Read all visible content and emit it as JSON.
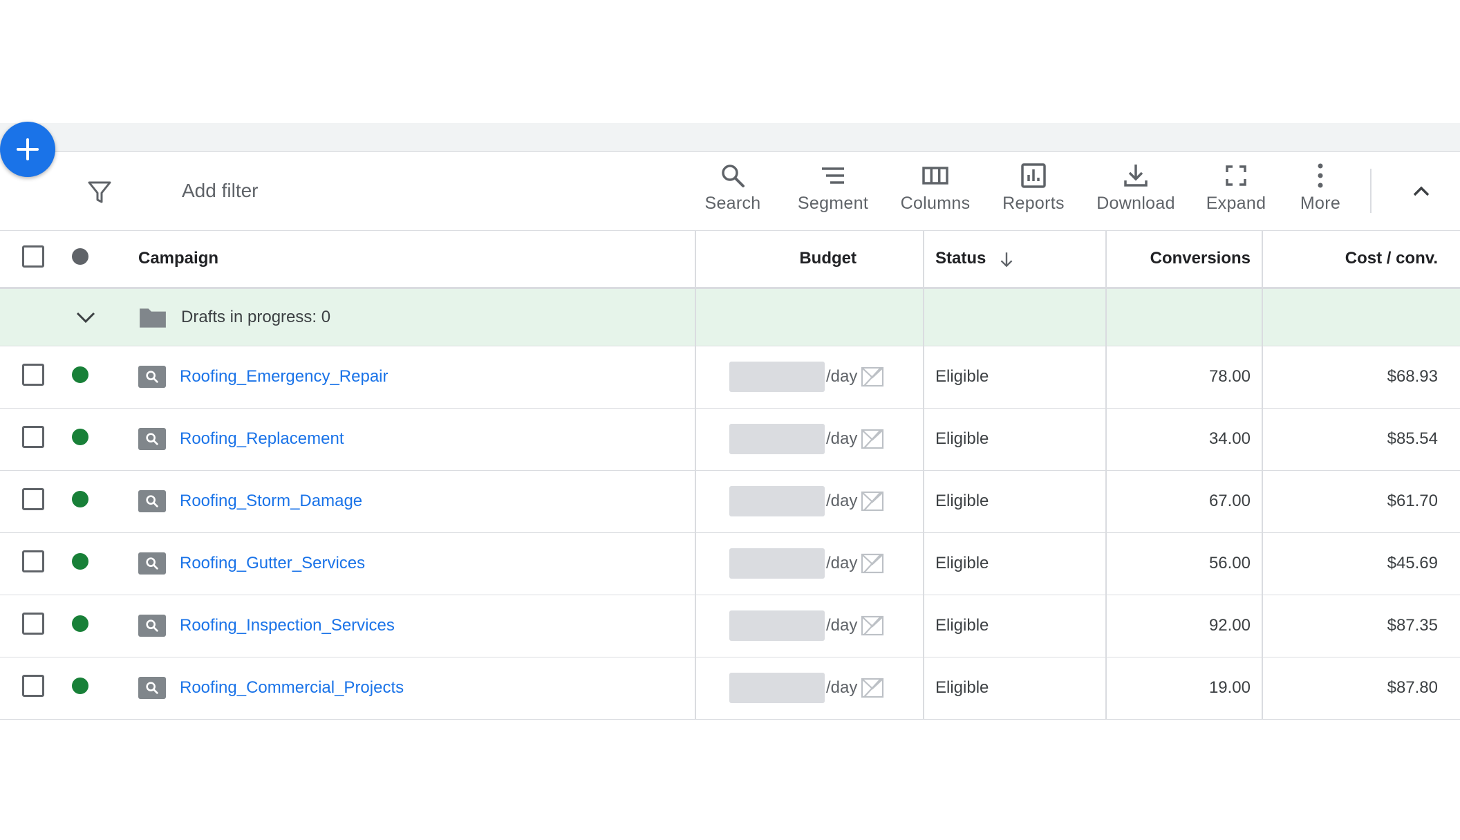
{
  "colors": {
    "brand_blue": "#1a73e8",
    "enabled_green": "#188038",
    "drafts_bg": "#e6f4ea",
    "link_blue": "#1a73e8"
  },
  "fab": {
    "icon": "plus-icon"
  },
  "toolbar": {
    "filter_icon": "filter-icon",
    "add_filter_label": "Add filter",
    "tools": {
      "search": {
        "label": "Search",
        "icon": "search-icon"
      },
      "segment": {
        "label": "Segment",
        "icon": "segment-icon"
      },
      "columns": {
        "label": "Columns",
        "icon": "columns-icon"
      },
      "reports": {
        "label": "Reports",
        "icon": "reports-icon"
      },
      "download": {
        "label": "Download",
        "icon": "download-icon"
      },
      "expand": {
        "label": "Expand",
        "icon": "expand-icon"
      },
      "more": {
        "label": "More",
        "icon": "more-vert-icon"
      }
    },
    "collapse_icon": "chevron-up-icon"
  },
  "table": {
    "headers": {
      "campaign": "Campaign",
      "budget": "Budget",
      "status": "Status",
      "conversions": "Conversions",
      "cost_per_conv": "Cost / conv."
    },
    "status_sort": "descending",
    "drafts": {
      "label": "Drafts in progress: 0"
    },
    "budget_unit": "/day",
    "rows": [
      {
        "name": "Roofing_Emergency_Repair",
        "status": "Eligible",
        "conversions": "78.00",
        "cost_per_conv": "$68.93"
      },
      {
        "name": "Roofing_Replacement",
        "status": "Eligible",
        "conversions": "34.00",
        "cost_per_conv": "$85.54"
      },
      {
        "name": "Roofing_Storm_Damage",
        "status": "Eligible",
        "conversions": "67.00",
        "cost_per_conv": "$61.70"
      },
      {
        "name": "Roofing_Gutter_Services",
        "status": "Eligible",
        "conversions": "56.00",
        "cost_per_conv": "$45.69"
      },
      {
        "name": "Roofing_Inspection_Services",
        "status": "Eligible",
        "conversions": "92.00",
        "cost_per_conv": "$87.35"
      },
      {
        "name": "Roofing_Commercial_Projects",
        "status": "Eligible",
        "conversions": "19.00",
        "cost_per_conv": "$87.80"
      }
    ]
  }
}
